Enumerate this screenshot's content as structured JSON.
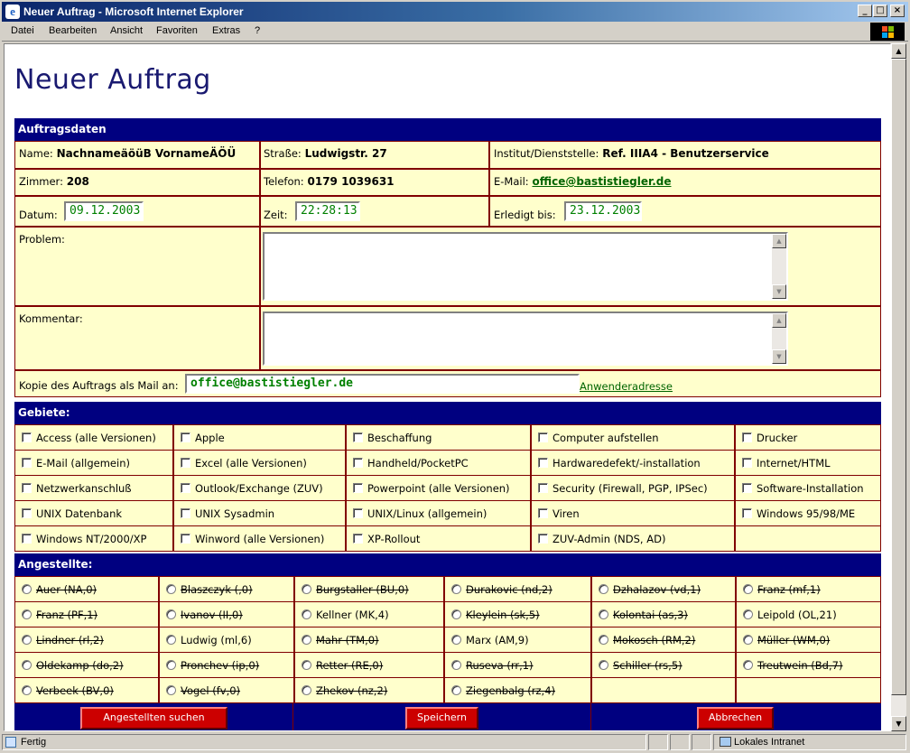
{
  "window": {
    "title": "Neuer Auftrag - Microsoft Internet Explorer"
  },
  "menu": [
    {
      "label": "Datei"
    },
    {
      "label": "Bearbeiten"
    },
    {
      "label": "Ansicht"
    },
    {
      "label": "Favoriten"
    },
    {
      "label": "Extras"
    },
    {
      "label": "?"
    }
  ],
  "page": {
    "title": "Neuer Auftrag"
  },
  "auftrag": {
    "header": "Auftragsdaten",
    "name_label": "Name:",
    "name_value": "NachnameäöüB VornameÄÖÜ",
    "strasse_label": "Straße:",
    "strasse_value": "Ludwigstr. 27",
    "institut_label": "Institut/Dienststelle:",
    "institut_value": "Ref. IIIA4 - Benutzerservice",
    "zimmer_label": "Zimmer:",
    "zimmer_value": "208",
    "telefon_label": "Telefon:",
    "telefon_value": "0179 1039631",
    "email_label": "E-Mail:",
    "email_value": "office@bastistiegler.de",
    "datum_label": "Datum:",
    "datum_value": "09.12.2003",
    "zeit_label": "Zeit:",
    "zeit_value": "22:28:13",
    "erledigt_label": "Erledigt bis:",
    "erledigt_value": "23.12.2003",
    "problem_label": "Problem:",
    "kommentar_label": "Kommentar:",
    "kopie_label": "Kopie des Auftrags als Mail an:",
    "kopie_value": "office@bastistiegler.de",
    "anwender_link": "Anwenderadresse"
  },
  "gebiete": {
    "header": "Gebiete:",
    "items": [
      "Access (alle Versionen)",
      "Apple",
      "Beschaffung",
      "Computer aufstellen",
      "Drucker",
      "E-Mail (allgemein)",
      "Excel (alle Versionen)",
      "Handheld/PocketPC",
      "Hardwaredefekt/-installation",
      "Internet/HTML",
      "Netzwerkanschluß",
      "Outlook/Exchange (ZUV)",
      "Powerpoint (alle Versionen)",
      "Security (Firewall, PGP, IPSec)",
      "Software-Installation",
      "UNIX Datenbank",
      "UNIX Sysadmin",
      "UNIX/Linux (allgemein)",
      "Viren",
      "Windows 95/98/ME",
      "Windows NT/2000/XP",
      "Winword (alle Versionen)",
      "XP-Rollout",
      "ZUV-Admin (NDS, AD)",
      ""
    ]
  },
  "angestellte": {
    "header": "Angestellte:",
    "items": [
      {
        "label": "Auer (NA,0)",
        "strike": true
      },
      {
        "label": "Blaszczyk (,0)",
        "strike": true
      },
      {
        "label": "Burgstaller (BU,0)",
        "strike": true
      },
      {
        "label": "Durakovic (nd,2)",
        "strike": true
      },
      {
        "label": "Dzhalazov (vd,1)",
        "strike": true
      },
      {
        "label": "Franz (mf,1)",
        "strike": true
      },
      {
        "label": "Franz (PF,1)",
        "strike": true
      },
      {
        "label": "Ivanov (II,0)",
        "strike": true
      },
      {
        "label": "Kellner (MK,4)",
        "strike": false
      },
      {
        "label": "Kleylein (sk,5)",
        "strike": true
      },
      {
        "label": "Kolontai (as,3)",
        "strike": true
      },
      {
        "label": "Leipold (OL,21)",
        "strike": false
      },
      {
        "label": "Lindner (rl,2)",
        "strike": true
      },
      {
        "label": "Ludwig (ml,6)",
        "strike": false
      },
      {
        "label": "Mahr (TM,0)",
        "strike": true
      },
      {
        "label": "Marx (AM,9)",
        "strike": false
      },
      {
        "label": "Mokosch (RM,2)",
        "strike": true
      },
      {
        "label": "Müller (WM,0)",
        "strike": true
      },
      {
        "label": "Oldekamp (do,2)",
        "strike": true
      },
      {
        "label": "Pronchev (ip,0)",
        "strike": true
      },
      {
        "label": "Retter (RE,0)",
        "strike": true
      },
      {
        "label": "Ruseva (rr,1)",
        "strike": true
      },
      {
        "label": "Schiller (rs,5)",
        "strike": true
      },
      {
        "label": "Treutwein (Bd,7)",
        "strike": true
      },
      {
        "label": "Verbeek (BV,0)",
        "strike": true
      },
      {
        "label": "Vogel (fv,0)",
        "strike": true
      },
      {
        "label": "Zhekov (nz,2)",
        "strike": true
      },
      {
        "label": "Ziegenbalg (rz,4)",
        "strike": true
      },
      {
        "label": "",
        "strike": false
      },
      {
        "label": "",
        "strike": false
      }
    ]
  },
  "buttons": {
    "search": "Angestellten suchen",
    "save": "Speichern",
    "cancel": "Abbrechen"
  },
  "status": {
    "left": "Fertig",
    "zone": "Lokales Intranet"
  },
  "colors": {
    "header_bg": "#000080",
    "cell_bg": "#ffffcc",
    "grid_border": "#800000",
    "title": "#191970",
    "button": "#cc0000",
    "value_green": "#008000"
  }
}
